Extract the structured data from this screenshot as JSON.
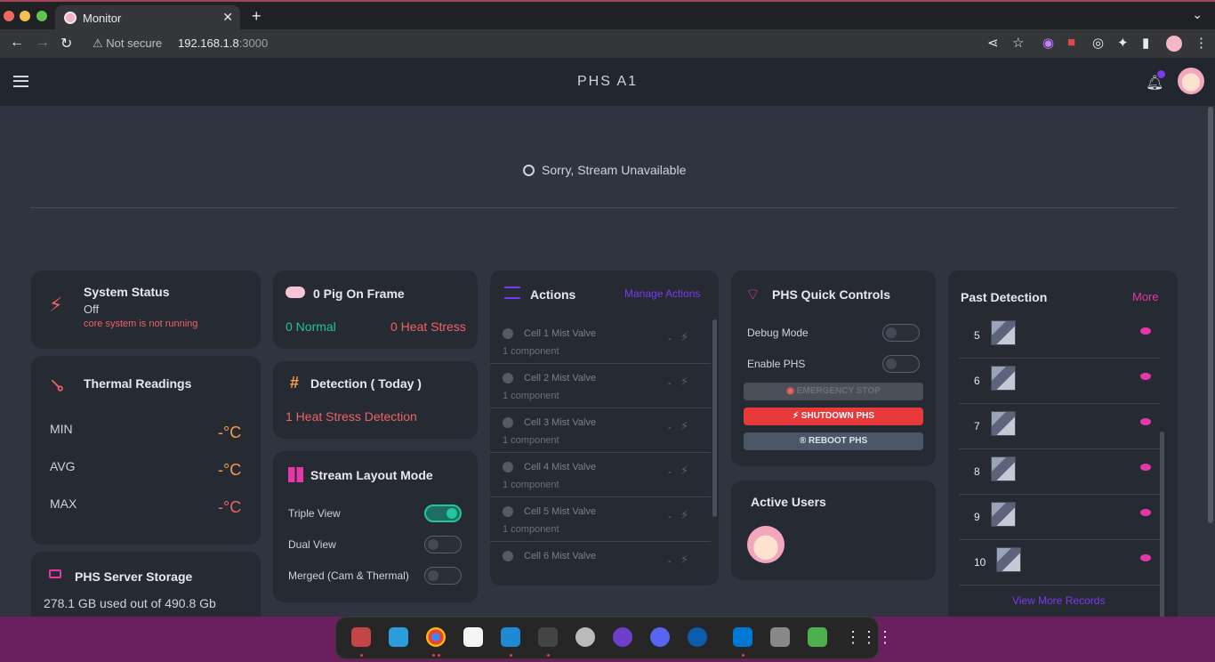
{
  "browser": {
    "tab_title": "Monitor",
    "not_secure": "Not secure",
    "url_host": "192.168.1.8",
    "url_port": ":3000"
  },
  "app": {
    "title": "PHS A1"
  },
  "stream": {
    "message": "Sorry, Stream Unavailable"
  },
  "system_status": {
    "title": "System Status",
    "state": "Off",
    "detail": "core system is not running"
  },
  "pig_frame": {
    "title": "0 Pig On Frame",
    "normal": "0 Normal",
    "heat": "0 Heat Stress"
  },
  "thermal": {
    "title": "Thermal Readings",
    "rows": [
      {
        "label": "MIN",
        "value": "-°C"
      },
      {
        "label": "AVG",
        "value": "-°C"
      },
      {
        "label": "MAX",
        "value": "-°C"
      }
    ]
  },
  "detection": {
    "title": "Detection ( Today )",
    "text": "1 Heat Stress Detection"
  },
  "layout_mode": {
    "title": "Stream Layout Mode",
    "options": [
      {
        "label": "Triple View",
        "on": true
      },
      {
        "label": "Dual View",
        "on": false
      },
      {
        "label": "Merged (Cam & Thermal)",
        "on": false
      }
    ]
  },
  "storage": {
    "title": "PHS Server Storage",
    "used": "278.1 GB used out of 490.8 Gb"
  },
  "actions": {
    "title": "Actions",
    "manage": "Manage Actions",
    "items": [
      {
        "name": "Cell 1 Mist Valve",
        "count": "1 component",
        "dash": "-"
      },
      {
        "name": "Cell 2 Mist Valve",
        "count": "1 component",
        "dash": "-"
      },
      {
        "name": "Cell 3 Mist Valve",
        "count": "1 component",
        "dash": "-"
      },
      {
        "name": "Cell 4 Mist Valve",
        "count": "1 component",
        "dash": "-"
      },
      {
        "name": "Cell 5 Mist Valve",
        "count": "1 component",
        "dash": "-"
      },
      {
        "name": "Cell 6 Mist Valve",
        "count": "",
        "dash": "-"
      }
    ]
  },
  "quick_controls": {
    "title": "PHS Quick Controls",
    "debug": "Debug Mode",
    "enable": "Enable PHS",
    "emergency": "EMERGENCY STOP",
    "shutdown": "SHUTDOWN PHS",
    "reboot": "REBOOT PHS"
  },
  "active_users": {
    "title": "Active Users"
  },
  "past_detection": {
    "title": "Past Detection",
    "more": "More",
    "items": [
      "5",
      "6",
      "7",
      "8",
      "9",
      "10"
    ],
    "view_more": "View More Records"
  },
  "colors": {
    "accent": "#7c3aed",
    "pink": "#e637a8",
    "danger": "#f06268",
    "warn": "#f59e42",
    "ok": "#22c58b"
  }
}
